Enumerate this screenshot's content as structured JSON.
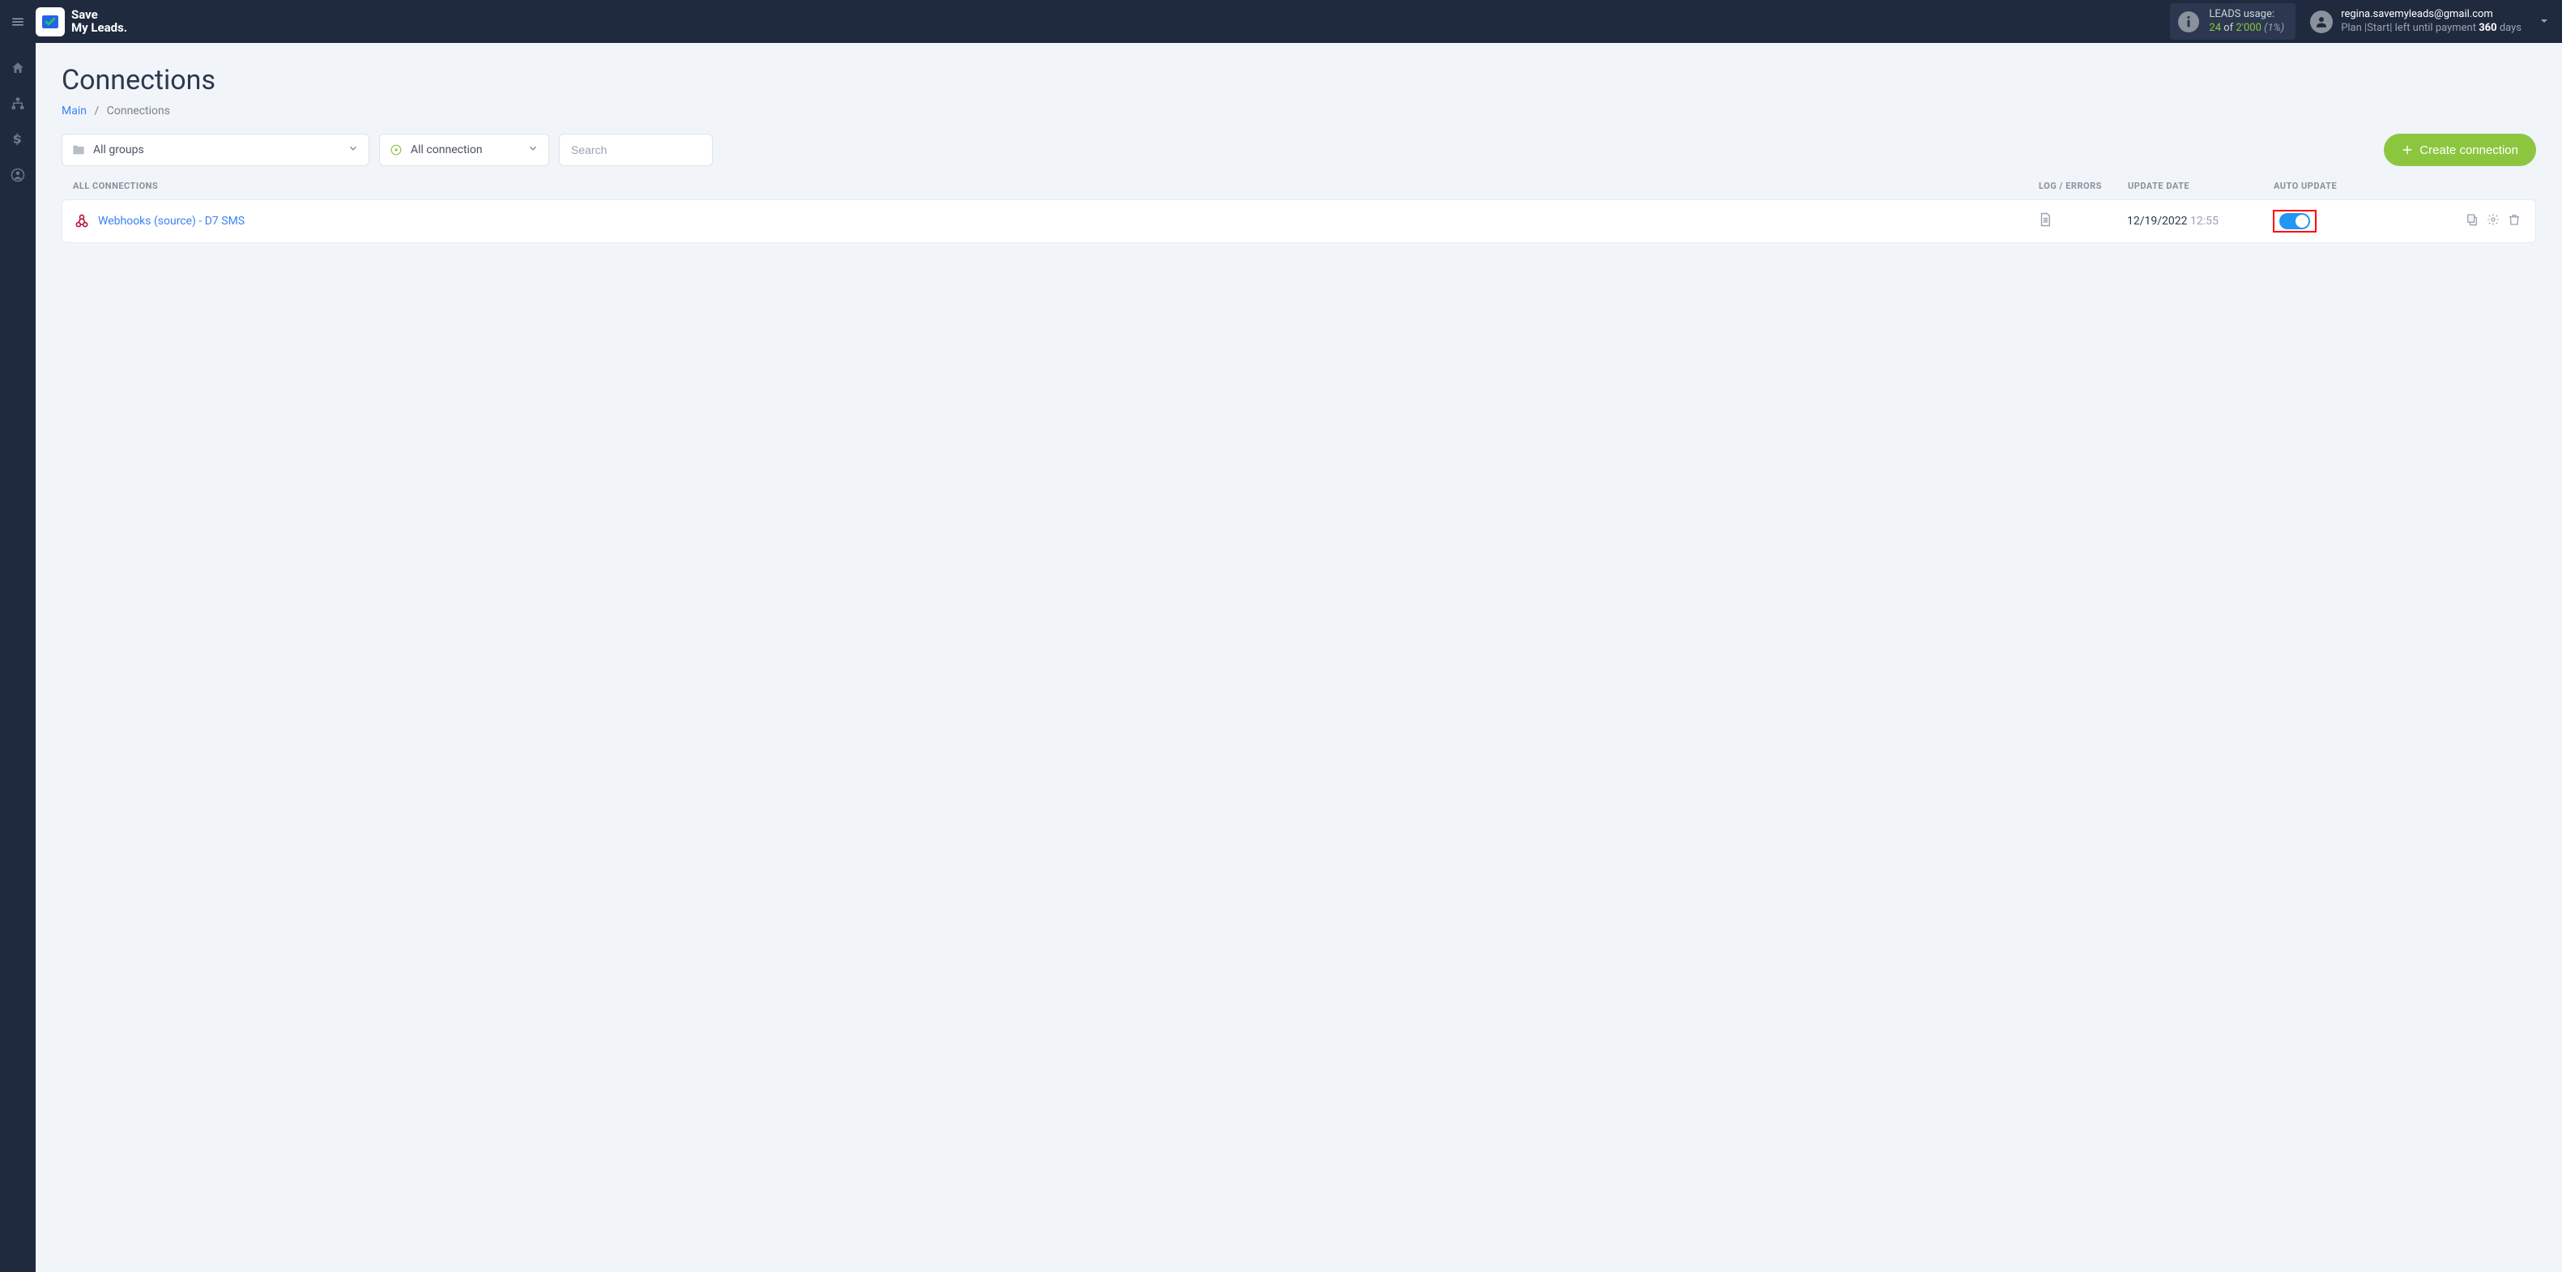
{
  "header": {
    "logo_line1": "Save",
    "logo_line2": "My Leads.",
    "usage": {
      "label": "LEADS usage:",
      "used": "24",
      "of_word": "of",
      "total": "2'000",
      "percent": "(1%)"
    },
    "account": {
      "email": "regina.savemyleads@gmail.com",
      "plan_prefix": "Plan |Start| left until payment",
      "days_num": "360",
      "days_word": "days"
    }
  },
  "page": {
    "title": "Connections",
    "breadcrumb_main": "Main",
    "breadcrumb_current": "Connections"
  },
  "filters": {
    "groups_label": "All groups",
    "conn_label": "All connection",
    "search_placeholder": "Search",
    "create_label": "Create connection"
  },
  "table": {
    "head_all": "ALL CONNECTIONS",
    "head_log": "LOG / ERRORS",
    "head_date": "UPDATE DATE",
    "head_auto": "AUTO UPDATE",
    "rows": [
      {
        "name": "Webhooks (source) - D7 SMS",
        "date": "12/19/2022",
        "time": "12:55"
      }
    ]
  }
}
